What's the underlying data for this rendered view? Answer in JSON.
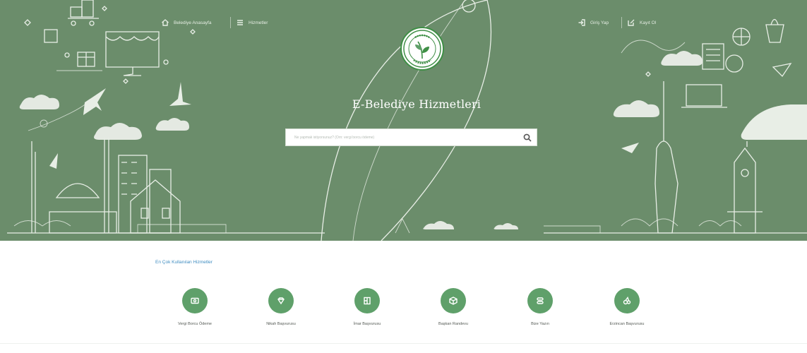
{
  "colors": {
    "hero_background": "#6b8d6b",
    "line_art": "#e8eee6",
    "service_icon_background": "#5fa06a",
    "section_title": "#3f8dc1",
    "logo_ring": "#3f8f46"
  },
  "header": {
    "left_links": [
      {
        "label": "Belediye Anasayfa",
        "icon": "home-icon"
      },
      {
        "label": "Hizmetler",
        "icon": "menu-icon"
      }
    ],
    "right_links": [
      {
        "label": "Giriş Yap",
        "icon": "login-icon"
      },
      {
        "label": "Kayıt Ol",
        "icon": "register-icon"
      }
    ]
  },
  "hero": {
    "logo_icon": "municipality-seal-icon",
    "title": "E-Belediye Hizmetleri",
    "search": {
      "placeholder": "Ne yapmak istiyorsunuz? (Örn: vergi borcu ödeme)",
      "icon": "search-icon"
    }
  },
  "popular": {
    "title": "En Çok Kullanılan Hizmetler",
    "items": [
      {
        "label": "Vergi Borcu Ödeme",
        "icon": "money-icon"
      },
      {
        "label": "Nikah Başvurusu",
        "icon": "diamond-ring-icon"
      },
      {
        "label": "İmar Başvurusu",
        "icon": "building-plan-icon"
      },
      {
        "label": "Başkan Randevu",
        "icon": "calendar-box-icon"
      },
      {
        "label": "Bize Yazın",
        "icon": "message-icon"
      },
      {
        "label": "Erzincan Başvurusu",
        "icon": "gallery-icon"
      }
    ]
  }
}
